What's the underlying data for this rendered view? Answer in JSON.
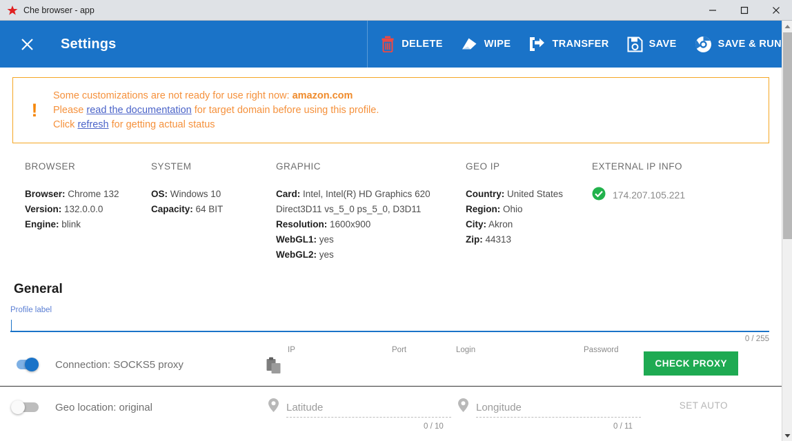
{
  "window": {
    "title": "Che browser - app",
    "app_icon": "star-icon",
    "minimize": "minimize-icon",
    "maximize": "maximize-icon",
    "close": "close-icon"
  },
  "appbar": {
    "close_label": "close-icon",
    "title": "Settings",
    "accent_color": "#1a73c8",
    "actions": [
      {
        "id": "delete",
        "label": "DELETE",
        "icon": "trash-icon",
        "icon_color": "#f4473f"
      },
      {
        "id": "wipe",
        "label": "WIPE",
        "icon": "eraser-icon",
        "icon_color": "#ffffff"
      },
      {
        "id": "transfer",
        "label": "TRANSFER",
        "icon": "share-icon",
        "icon_color": "#ffffff"
      },
      {
        "id": "save",
        "label": "SAVE",
        "icon": "floppy-icon",
        "icon_color": "#ffffff"
      },
      {
        "id": "save_run",
        "label": "SAVE & RUN",
        "icon": "chrome-icon",
        "icon_color": "#ffffff"
      }
    ]
  },
  "warning": {
    "icon": "exclamation-icon",
    "accent_color": "#f5a623",
    "line1_pre": "Some customizations are not ready for use right now: ",
    "line1_domain": "amazon.com",
    "line2_pre": "Please ",
    "line2_link": "read the documentation",
    "line2_post": " for target domain before using this profile.",
    "line3_pre": "Click ",
    "line3_link": "refresh",
    "line3_post": " for getting actual status"
  },
  "info": {
    "browser": {
      "heading": "BROWSER",
      "rows": [
        {
          "key": "Browser:",
          "value": " Chrome 132"
        },
        {
          "key": "Version:",
          "value": " 132.0.0.0"
        },
        {
          "key": "Engine:",
          "value": " blink"
        }
      ]
    },
    "system": {
      "heading": "SYSTEM",
      "rows": [
        {
          "key": "OS:",
          "value": " Windows 10"
        },
        {
          "key": "Capacity:",
          "value": " 64 BIT"
        }
      ]
    },
    "graphic": {
      "heading": "GRAPHIC",
      "rows": [
        {
          "key": "Card:",
          "value": " Intel, Intel(R) HD Graphics 620"
        },
        {
          "key": "",
          "value": "Direct3D11 vs_5_0 ps_5_0, D3D11"
        },
        {
          "key": "Resolution:",
          "value": " 1600x900"
        },
        {
          "key": "WebGL1:",
          "value": " yes"
        },
        {
          "key": "WebGL2:",
          "value": " yes"
        }
      ]
    },
    "geoip": {
      "heading": "GEO IP",
      "rows": [
        {
          "key": "Country:",
          "value": " United States"
        },
        {
          "key": "Region:",
          "value": " Ohio"
        },
        {
          "key": "City:",
          "value": " Akron"
        },
        {
          "key": "Zip:",
          "value": " 44313"
        }
      ]
    },
    "external_ip": {
      "heading": "EXTERNAL IP INFO",
      "status_icon": "check-circle-icon",
      "status_color": "#22b24c",
      "ip": "174.207.105.221"
    }
  },
  "general": {
    "section_title": "General",
    "profile_label": "Profile label",
    "profile_value": "",
    "profile_placeholder": "",
    "profile_counter": "0 / 255"
  },
  "proxy": {
    "toggle_state": "on",
    "label": "Connection: SOCKS5 proxy",
    "paste_icon": "clipboard-paste-icon",
    "fields": [
      {
        "id": "ip",
        "label": "IP",
        "value": ""
      },
      {
        "id": "port",
        "label": "Port",
        "value": ""
      },
      {
        "id": "login",
        "label": "Login",
        "value": ""
      },
      {
        "id": "password",
        "label": "Password",
        "value": ""
      }
    ],
    "check_button": "CHECK PROXY",
    "check_button_color": "#1eaa52"
  },
  "geo": {
    "toggle_state": "off",
    "label": "Geo location: original",
    "latitude": {
      "icon": "map-pin-icon",
      "placeholder": "Latitude",
      "value": "",
      "counter": "0 / 10"
    },
    "longitude": {
      "icon": "map-pin-icon",
      "placeholder": "Longitude",
      "value": "",
      "counter": "0 / 11"
    },
    "set_auto": "SET AUTO"
  },
  "scrollbar": {
    "up_arrow": "chevron-up-icon",
    "down_arrow": "chevron-down-icon"
  }
}
